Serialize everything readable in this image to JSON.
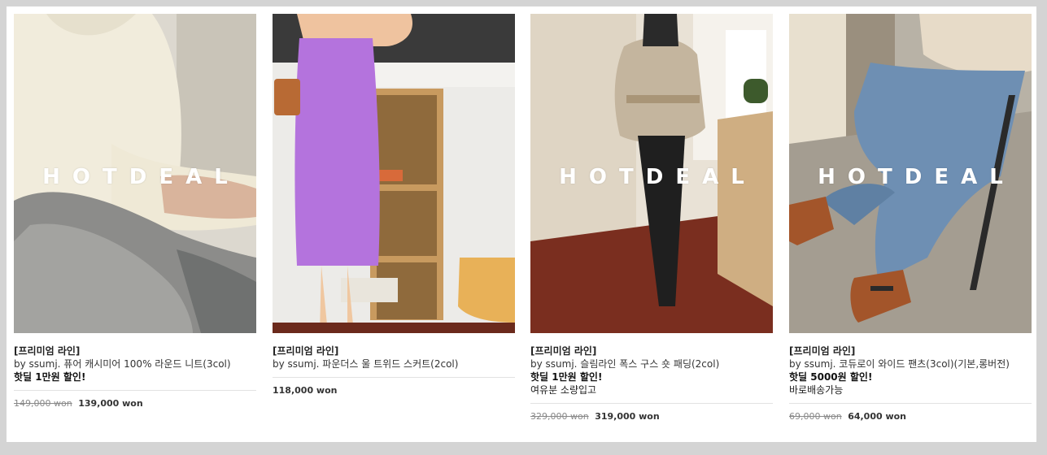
{
  "overlay_text": "HOTDEAL",
  "products": [
    {
      "label": "[프리미엄 라인]",
      "name": "by ssumj. 퓨어 캐시미어 100% 라운드 니트(3col)",
      "discount": "핫딜 1만원 할인!",
      "extra": "",
      "original_price": "149,000 won",
      "price": "139,000 won"
    },
    {
      "label": "[프리미엄 라인]",
      "name": "by ssumj. 파운더스 울 트위드 스커트(2col)",
      "discount": "",
      "extra": "",
      "original_price": "",
      "price": "118,000 won"
    },
    {
      "label": "[프리미엄 라인]",
      "name": "by ssumj. 슬림라인 폭스 구스 숏 패딩(2col)",
      "discount": "핫딜 1만원 할인!",
      "extra": "여유분 소량입고",
      "original_price": "329,000 won",
      "price": "319,000 won"
    },
    {
      "label": "[프리미엄 라인]",
      "name": "by ssumj. 코듀로이 와이드 팬츠(3col)(기본,롱버전)",
      "discount": "핫딜 5000원 할인!",
      "extra": "바로배송가능",
      "original_price": "69,000 won",
      "price": "64,000 won"
    }
  ]
}
